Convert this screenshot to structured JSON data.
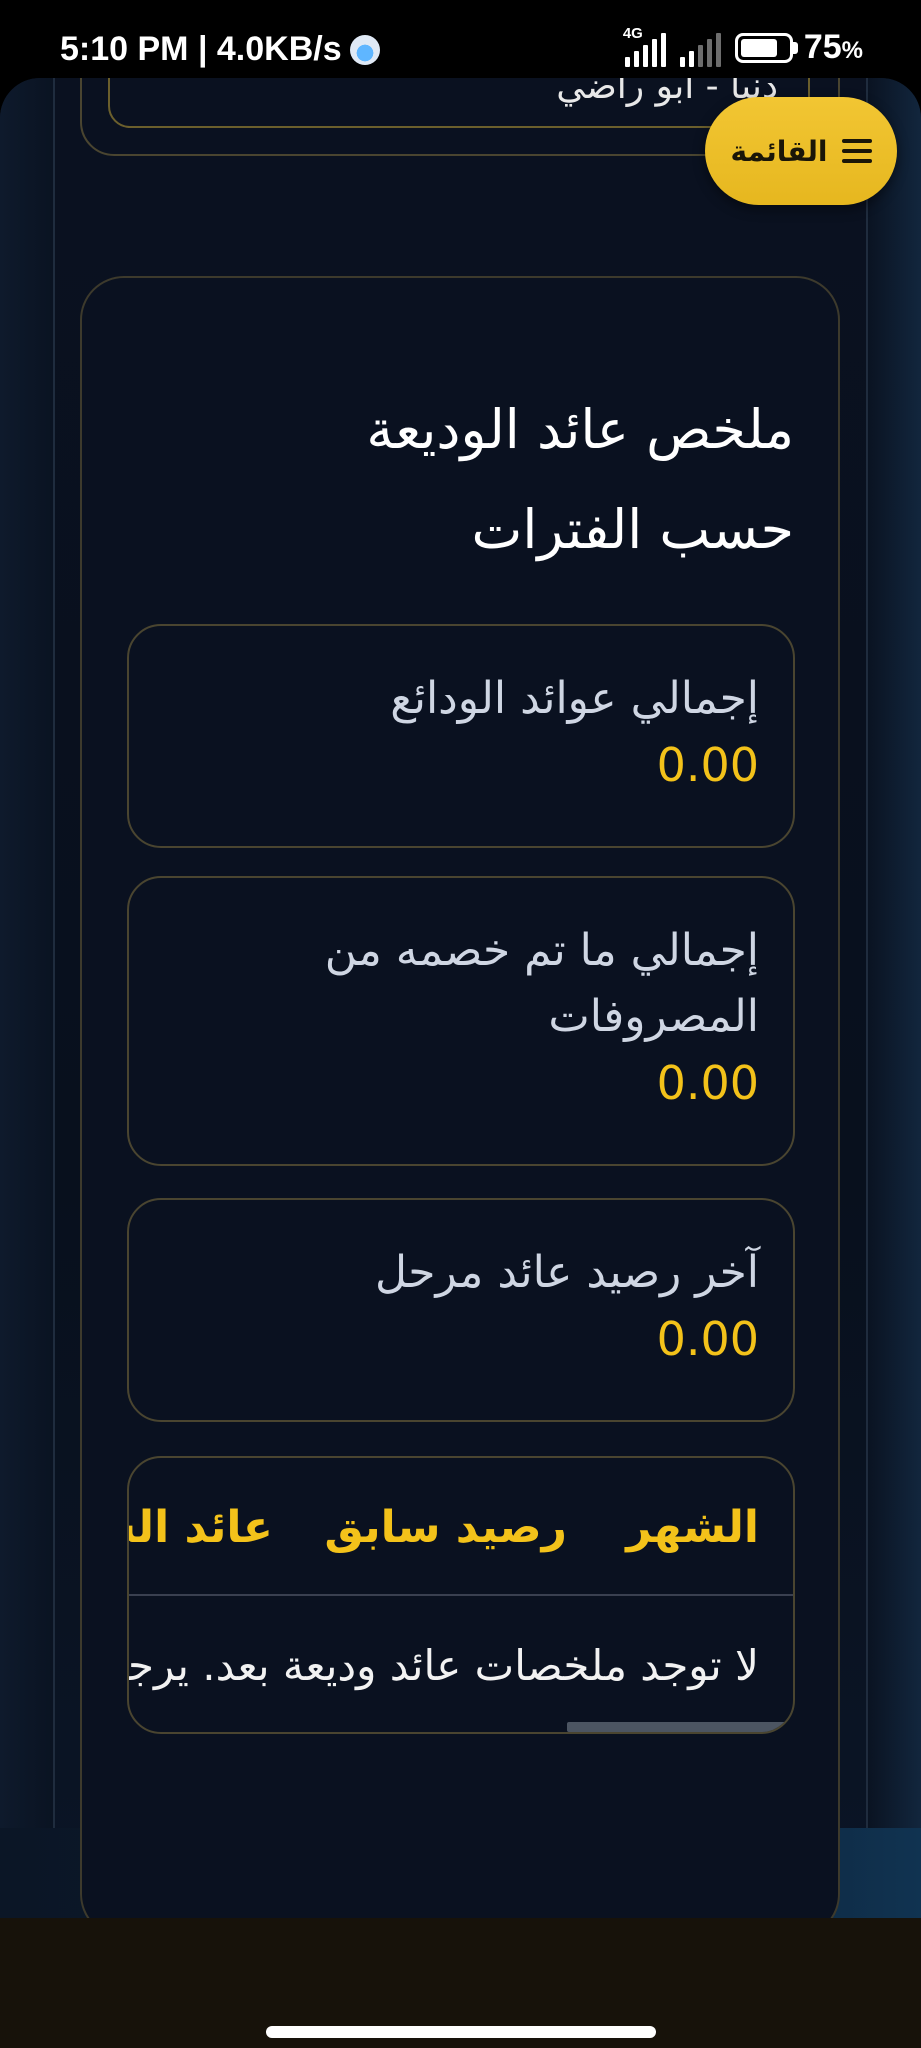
{
  "status_bar": {
    "time_speed": "5:10 PM | 4.0KB/s",
    "network_type": "4G",
    "battery_percent": "75",
    "battery_unit": "%"
  },
  "previous_card": {
    "text": "دنيا - ابو راضي"
  },
  "menu": {
    "label": "القائمة"
  },
  "summary": {
    "title": "ملخص عائد الوديعة حسب الفترات",
    "stats": [
      {
        "label": "إجمالي عوائد الودائع",
        "value": "0.00"
      },
      {
        "label": "إجمالي ما تم خصمه من المصروفات",
        "value": "0.00"
      },
      {
        "label": "آخر رصيد عائد مرحل",
        "value": "0.00"
      }
    ]
  },
  "table": {
    "columns": [
      "الشهر",
      "رصيد سابق",
      "عائد الشهر"
    ],
    "empty_message": "لا توجد ملخصات عائد وديعة بعد. يرجى"
  },
  "colors": {
    "accent": "#f3c21a",
    "background": "#0a1120",
    "card_border": "#4a4530"
  }
}
